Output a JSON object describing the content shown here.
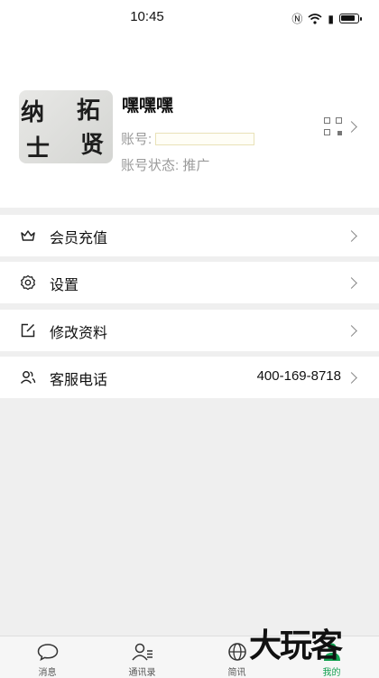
{
  "status_bar": {
    "time": "10:45"
  },
  "profile": {
    "nickname": "嘿嘿嘿",
    "account_label": "账号:",
    "account_value": "",
    "status_text": "账号状态: 推广",
    "avatar_text": [
      "纳",
      "拓",
      "士",
      "贤"
    ]
  },
  "menu": [
    {
      "label": "会员充值",
      "icon": "crown-icon",
      "value": ""
    },
    {
      "label": "设置",
      "icon": "gear-icon",
      "value": ""
    },
    {
      "label": "修改资料",
      "icon": "edit-icon",
      "value": ""
    },
    {
      "label": "客服电话",
      "icon": "contacts-icon",
      "value": "400-169-8718"
    }
  ],
  "nav": [
    {
      "label": "消息",
      "icon": "chat-bubble-icon",
      "active": false
    },
    {
      "label": "通讯录",
      "icon": "contacts-book-icon",
      "active": false
    },
    {
      "label": "简讯",
      "icon": "globe-icon",
      "active": false
    },
    {
      "label": "我的",
      "icon": "person-icon",
      "active": true
    }
  ],
  "watermark": "大玩客",
  "colors": {
    "accent": "#12a150",
    "page_bg": "#efefef"
  }
}
